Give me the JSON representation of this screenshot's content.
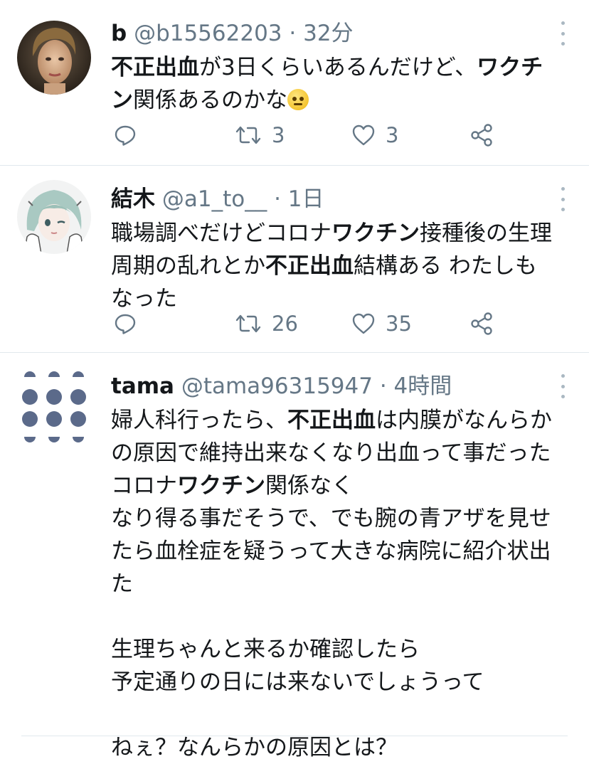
{
  "tweets": [
    {
      "name": "b",
      "handle": "@b15562203",
      "sep": "·",
      "time": "32分",
      "lines": [
        [
          {
            "t": "不正出血",
            "b": true
          },
          {
            "t": "が3日くらいあるんだけど、"
          },
          {
            "t": "ワクチ",
            "b": true
          }
        ],
        [
          {
            "t": "ン",
            "b": true
          },
          {
            "t": "関係あるのかな"
          }
        ]
      ],
      "emoji": "eye-roll-face",
      "reply_count": "",
      "retweet_count": "3",
      "like_count": "3"
    },
    {
      "name": "結木",
      "handle": "@a1_to__",
      "sep": "·",
      "time": "1日",
      "lines": [
        [
          {
            "t": "職場調べだけどコロナ"
          },
          {
            "t": "ワクチン",
            "b": true
          },
          {
            "t": "接種後の生理"
          }
        ],
        [
          {
            "t": "周期の乱れとか"
          },
          {
            "t": "不正出血",
            "b": true
          },
          {
            "t": "結構ある わたしも"
          }
        ],
        [
          {
            "t": "なった"
          }
        ]
      ],
      "reply_count": "",
      "retweet_count": "26",
      "like_count": "35"
    },
    {
      "name": "tama",
      "handle": "@tama96315947",
      "sep": "·",
      "time": "4時間",
      "lines": [
        [
          {
            "t": "婦人科行ったら、"
          },
          {
            "t": "不正出血",
            "b": true
          },
          {
            "t": "は内膜がなんらか"
          }
        ],
        [
          {
            "t": "の原因で維持出来なくなり出血って事だった"
          }
        ],
        [
          {
            "t": "コロナ"
          },
          {
            "t": "ワクチン",
            "b": true
          },
          {
            "t": "関係なく"
          }
        ],
        [
          {
            "t": "なり得る事だそうで、でも腕の青アザを見せ"
          }
        ],
        [
          {
            "t": "たら血栓症を疑うって大きな病院に紹介状出"
          }
        ],
        [
          {
            "t": "た"
          }
        ],
        [],
        [
          {
            "t": "生理ちゃんと来るか確認したら"
          }
        ],
        [
          {
            "t": "予定通りの日には来ないでしょうって"
          }
        ],
        [],
        [
          {
            "t": "ねぇ？なんらかの原因とは？"
          }
        ]
      ]
    }
  ],
  "colors": {
    "text": "#14171a",
    "secondary": "#657786",
    "divider": "#e1e8ed",
    "avatar_dots": "#5b6a8a"
  },
  "icons": [
    "reply-icon",
    "retweet-icon",
    "like-icon",
    "share-icon",
    "more-icon"
  ]
}
